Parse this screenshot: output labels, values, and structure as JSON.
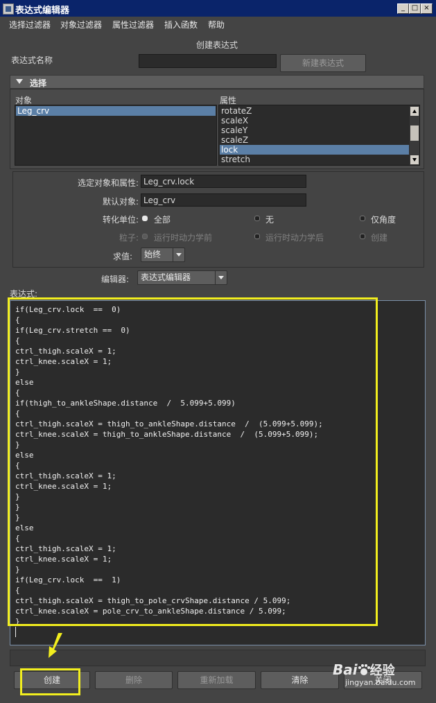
{
  "window": {
    "title": "表达式编辑器",
    "controls": [
      "_",
      "□",
      "×"
    ]
  },
  "menu": [
    "选择过滤器",
    "对象过滤器",
    "属性过滤器",
    "插入函数",
    "帮助"
  ],
  "mode_title": "创建表达式",
  "expr_name": {
    "label": "表达式名称",
    "value": "",
    "new_button": "新建表达式"
  },
  "selection": {
    "header": "选择",
    "objects_label": "对象",
    "attributes_label": "属性",
    "objects": [
      {
        "label": "Leg_crv",
        "selected": true
      }
    ],
    "attributes": [
      {
        "label": "rotateZ",
        "selected": false
      },
      {
        "label": "scaleX",
        "selected": false
      },
      {
        "label": "scaleY",
        "selected": false
      },
      {
        "label": "scaleZ",
        "selected": false
      },
      {
        "label": "lock",
        "selected": true
      },
      {
        "label": "stretch",
        "selected": false
      }
    ]
  },
  "options": {
    "selected_attr_label": "选定对象和属性:",
    "selected_attr_value": "Leg_crv.lock",
    "default_object_label": "默认对象:",
    "default_object_value": "Leg_crv",
    "convert_units_label": "转化单位:",
    "convert_units": [
      {
        "label": "全部",
        "checked": true
      },
      {
        "label": "无",
        "checked": false
      },
      {
        "label": "仅角度",
        "checked": false
      }
    ],
    "particle_label": "粒子:",
    "particle": [
      {
        "label": "运行时动力学前",
        "checked": true
      },
      {
        "label": "运行时动力学后",
        "checked": false
      },
      {
        "label": "创建",
        "checked": false
      }
    ],
    "evaluate_label": "求值:",
    "evaluate_value": "始终"
  },
  "editor_label": "编辑器:",
  "editor_value": "表达式编辑器",
  "expression_label": "表达式:",
  "code": [
    "if(Leg_crv.lock  ==  0)",
    "{",
    "if(Leg_crv.stretch ==  0)",
    "{",
    "ctrl_thigh.scaleX = 1;",
    "ctrl_knee.scaleX = 1;",
    "}",
    "else",
    "{",
    "if(thigh_to_ankleShape.distance  /  5.099+5.099)",
    "{",
    "ctrl_thigh.scaleX = thigh_to_ankleShape.distance  /  (5.099+5.099);",
    "ctrl_knee.scaleX = thigh_to_ankleShape.distance  /  (5.099+5.099);",
    "}",
    "else",
    "{",
    "ctrl_thigh.scaleX = 1;",
    "ctrl_knee.scaleX = 1;",
    "}",
    "}",
    "}",
    "else",
    "{",
    "ctrl_thigh.scaleX = 1;",
    "ctrl_knee.scaleX = 1;",
    "}",
    "if(Leg_crv.lock  ==  1)",
    "{",
    "ctrl_thigh.scaleX = thigh_to_pole_crvShape.distance / 5.099;",
    "ctrl_knee.scaleX = pole_crv_to_ankleShape.distance / 5.099;",
    "}"
  ],
  "buttons": {
    "create": "创建",
    "delete": "删除",
    "reload": "重新加载",
    "clear": "清除",
    "close": "关闭"
  },
  "watermark": {
    "brand_a": "Bai",
    "brand_b": "经验",
    "url": "jingyan.baidu.com"
  },
  "colors": {
    "highlight": "#f2ee1e",
    "selection": "#5b7fa6",
    "titlebar": "#0a246a"
  }
}
